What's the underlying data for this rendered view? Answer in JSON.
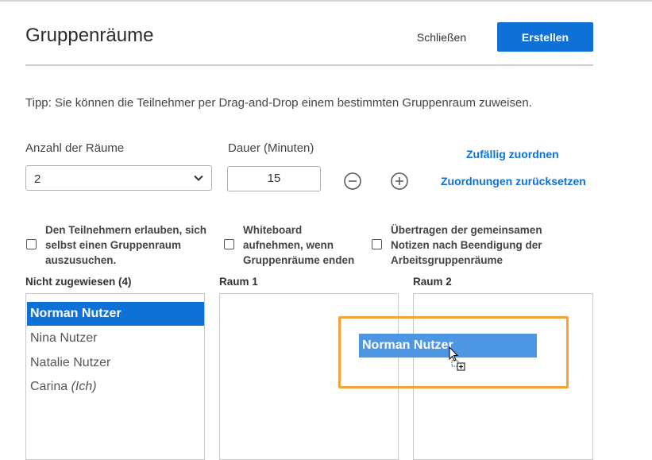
{
  "dialog": {
    "title": "Gruppenräume",
    "close_label": "Schließen",
    "create_label": "Erstellen",
    "tip": "Tipp: Sie können die Teilnehmer per Drag-and-Drop einem bestimmten Gruppenraum zuweisen."
  },
  "settings": {
    "rooms_label": "Anzahl der Räume",
    "rooms_value": "2",
    "duration_label": "Dauer (Minuten)",
    "duration_value": "15",
    "random_assign": "Zufällig zuordnen",
    "reset_assign": "Zuordnungen zurücksetzen"
  },
  "options": [
    {
      "lines": [
        "Den Teilnehmern erlauben, sich",
        "selbst einen Gruppenraum",
        "auszusuchen."
      ],
      "checked": false
    },
    {
      "lines": [
        "Whiteboard",
        "aufnehmen, wenn",
        "Gruppenräume enden"
      ],
      "checked": false
    },
    {
      "lines": [
        "Übertragen der gemeinsamen",
        "Notizen nach Beendigung der",
        "Arbeitsgruppenräume"
      ],
      "checked": false
    }
  ],
  "lists": {
    "unassigned_header": "Nicht zugewiesen (4)",
    "room1_header": "Raum 1",
    "room2_header": "Raum 2",
    "unassigned": [
      {
        "name": "Norman Nutzer",
        "selected": true
      },
      {
        "name": "Nina Nutzer",
        "selected": false
      },
      {
        "name": "Natalie Nutzer",
        "selected": false
      },
      {
        "name": "Carina",
        "suffix": "(Ich)",
        "selected": false
      }
    ]
  },
  "drag": {
    "label": "Norman Nutzer"
  },
  "colors": {
    "accent": "#0f70d7",
    "drag": "#4d96e4",
    "highlight": "#f5a23a"
  }
}
